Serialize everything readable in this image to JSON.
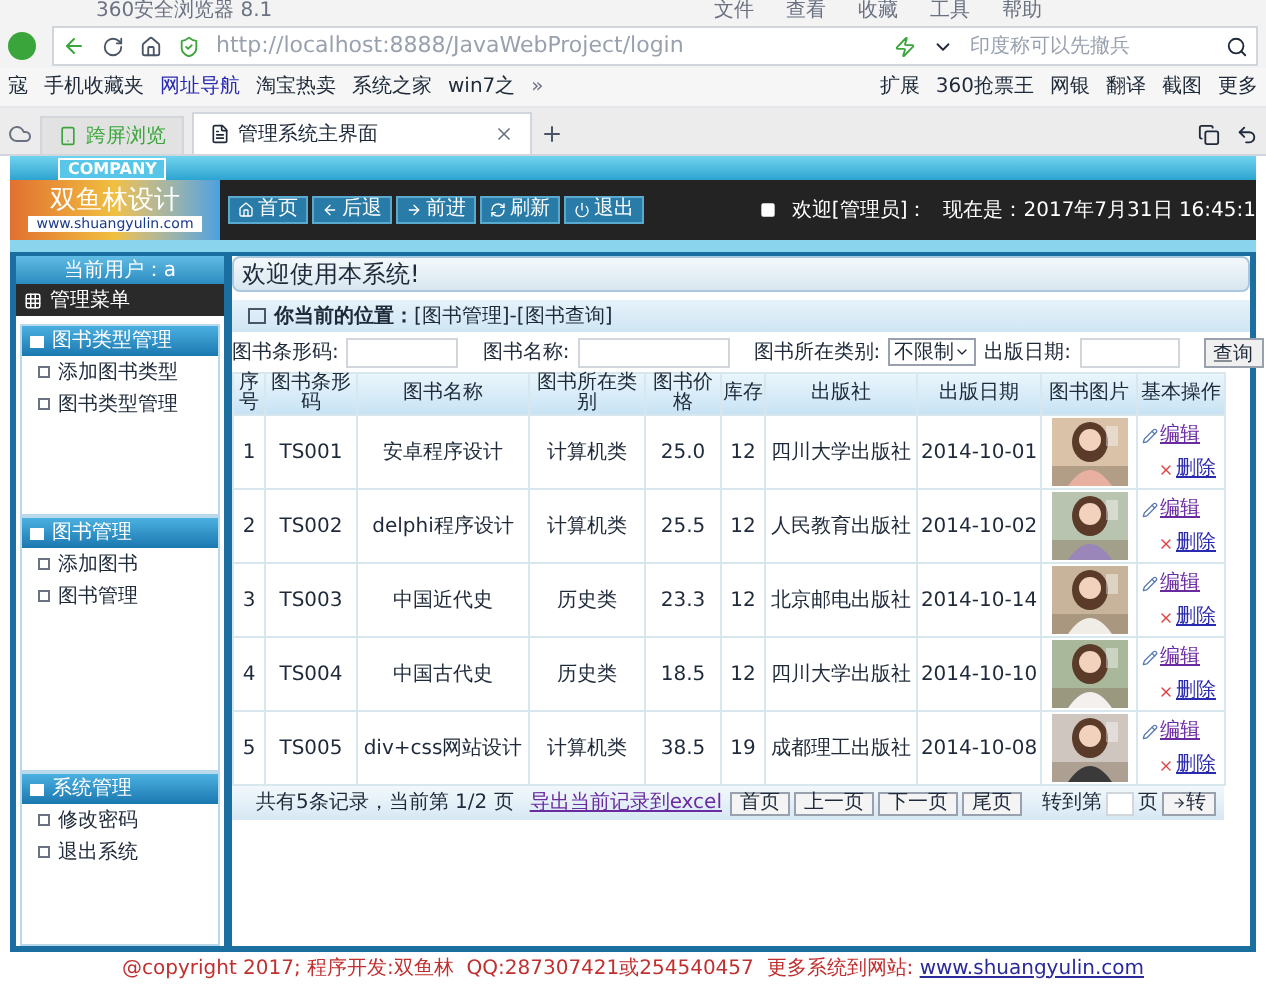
{
  "browser": {
    "title": "360安全浏览器 8.1",
    "menu": [
      "文件",
      "查看",
      "收藏",
      "工具",
      "帮助"
    ],
    "url": "http://localhost:8888/JavaWebProject/login",
    "search_placeholder": "印度称可以先撤兵",
    "bookmarks": [
      "寇",
      "手机收藏夹",
      "网址导航",
      "淘宝热卖",
      "系统之家",
      "win7之"
    ],
    "more": "»",
    "bookmarks_right": [
      "扩展",
      "360抢票王",
      "网银",
      "翻译",
      "截图",
      "更多"
    ],
    "tabs": [
      {
        "label": "跨屏浏览",
        "selected": false
      },
      {
        "label": "管理系统主界面",
        "selected": true
      }
    ]
  },
  "header": {
    "company": "COMPANY",
    "logo_text": "双鱼林设计",
    "logo_url": "www.shuangyulin.com",
    "nav": [
      "首页",
      "后退",
      "前进",
      "刷新",
      "退出"
    ],
    "welcome": "欢迎[管理员]：",
    "time": "现在是：2017年7月31日 16:45:1"
  },
  "sidebar": {
    "user": "当前用户：a",
    "menu_title": "管理菜单",
    "groups": [
      {
        "title": "图书类型管理",
        "items": [
          "添加图书类型",
          "图书类型管理"
        ]
      },
      {
        "title": "图书管理",
        "items": [
          "添加图书",
          "图书管理"
        ]
      },
      {
        "title": "系统管理",
        "items": [
          "修改密码",
          "退出系统"
        ]
      }
    ]
  },
  "main": {
    "welcome": "欢迎使用本系统!",
    "location": "**你当前的位置：**[图书管理]-[图书查询]",
    "search": {
      "barcode_label": "图书条形码:",
      "name_label": "图书名称:",
      "type_label": "图书所在类别:",
      "type_value": "不限制",
      "date_label": "出版日期:",
      "button": "查询"
    },
    "columns": [
      "序号",
      "图书条形码",
      "图书名称",
      "图书所在类别",
      "图书价格",
      "库存",
      "出版社",
      "出版日期",
      "图书图片",
      "基本操作"
    ],
    "rows": [
      {
        "cells": [
          "1",
          "TS001",
          "安卓程序设计",
          "计算机类",
          "25.0",
          "12",
          "四川大学出版社",
          "2014-10-01"
        ],
        "edit": "编辑",
        "delete": "删除"
      },
      {
        "cells": [
          "2",
          "TS002",
          "delphi程序设计",
          "计算机类",
          "25.5",
          "12",
          "人民教育出版社",
          "2014-10-02"
        ],
        "edit": "编辑",
        "delete": "删除"
      },
      {
        "cells": [
          "3",
          "TS003",
          "中国近代史",
          "历史类",
          "23.3",
          "12",
          "北京邮电出版社",
          "2014-10-14"
        ],
        "edit": "编辑",
        "delete": "删除"
      },
      {
        "cells": [
          "4",
          "TS004",
          "中国古代史",
          "历史类",
          "18.5",
          "12",
          "四川大学出版社",
          "2014-10-10"
        ],
        "edit": "编辑",
        "delete": "删除"
      },
      {
        "cells": [
          "5",
          "TS005",
          "div+css网站设计",
          "计算机类",
          "38.5",
          "19",
          "成都理工出版社",
          "2014-10-08"
        ],
        "edit": "编辑",
        "delete": "删除"
      }
    ],
    "pager": {
      "summary": "共有5条记录，当前第 1/2 页",
      "export": "导出当前记录到excel",
      "buttons": [
        "首页",
        "上一页",
        "下一页",
        "尾页"
      ],
      "goto": "转到第",
      "page_unit": "页",
      "go": "转"
    }
  },
  "footer": {
    "text": "@copyright 2017; 程序开发:双鱼林  QQ:287307421或254540457  更多系统到网站: ",
    "url": "www.shuangyulin.com"
  }
}
